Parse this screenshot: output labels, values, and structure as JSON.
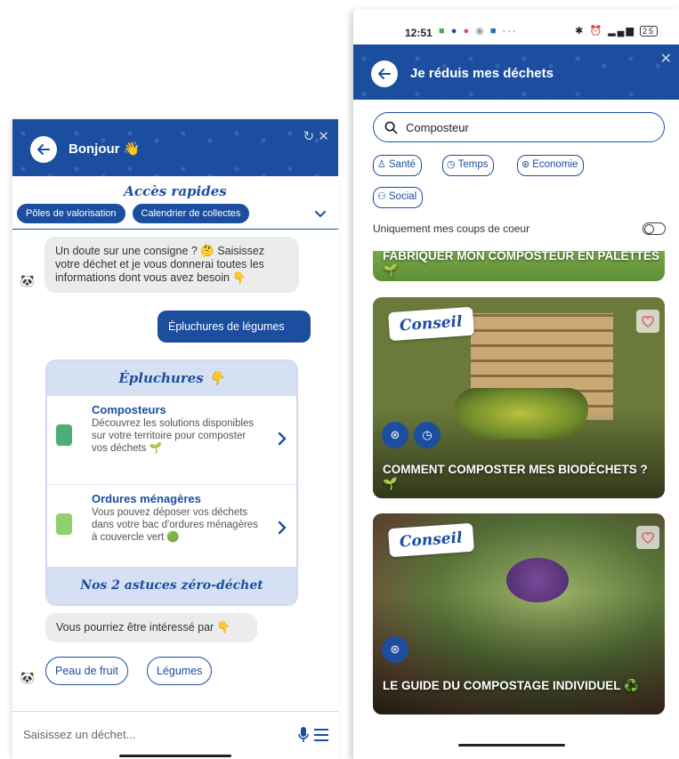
{
  "left_screen": {
    "header": {
      "title": "Bonjour 👋",
      "back_icon": "arrow-left-icon"
    },
    "quick_access": {
      "title": "Accès rapides",
      "buttons": [
        "Pôles de valorisation",
        "Calendrier de collectes"
      ]
    },
    "bot_message_1": "Un doute sur une consigne ? 🤔 Saisissez votre déchet et je vous donnerai toutes les informations dont vous avez besoin 👇",
    "user_message": "Épluchures de légumes",
    "result_card": {
      "title": "Épluchures 👇",
      "items": [
        {
          "title": "Composteurs",
          "description": "Découvrez les solutions disponibles sur votre territoire pour composter vos déchets 🌱"
        },
        {
          "title": "Ordures ménagères",
          "description": "Vous pouvez déposer vos déchets dans votre bac d'ordures ménagères à couvercle vert 🟢"
        }
      ],
      "footer": "Nos 2 astuces zéro-déchet"
    },
    "bot_message_2": "Vous pourriez être intéressé par 👇",
    "suggestions": [
      "Peau de fruit",
      "Légumes"
    ],
    "input": {
      "placeholder": "Saisissez un déchet..."
    },
    "colors": {
      "brand_blue": "#1c4ea0",
      "light_blue": "#d5e0f3"
    }
  },
  "right_screen": {
    "status_bar": {
      "time": "12:51",
      "battery": "25"
    },
    "header": {
      "title": "Je réduis mes déchets",
      "back_icon": "arrow-left-icon",
      "close_icon": "close-icon"
    },
    "search": {
      "value": "Composteur"
    },
    "filters": [
      "Santé",
      "Temps",
      "Economie",
      "Social"
    ],
    "favorites_toggle": {
      "label": "Uniquement mes coups de coeur",
      "on": false
    },
    "articles": [
      {
        "title": "FABRIQUER MON COMPOSTEUR EN PALETTES 🌱",
        "badge": ""
      },
      {
        "title": "COMMENT COMPOSTER MES BIODÉCHETS ? 🌱",
        "badge": "Conseil"
      },
      {
        "title": "LE GUIDE DU COMPOSTAGE INDIVIDUEL ♻️",
        "badge": "Conseil"
      }
    ]
  }
}
